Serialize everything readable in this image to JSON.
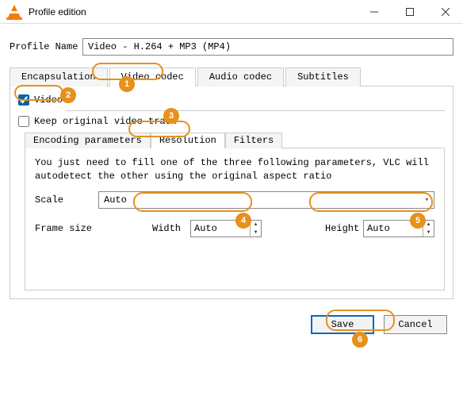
{
  "window": {
    "title": "Profile edition"
  },
  "profile": {
    "label": "Profile Name",
    "value": "Video - H.264 + MP3 (MP4)"
  },
  "tabs": {
    "encapsulation": "Encapsulation",
    "video": "Video codec",
    "audio": "Audio codec",
    "subs": "Subtitles"
  },
  "video": {
    "checkbox": "Video",
    "keep": "Keep original video track",
    "subtabs": {
      "enc": "Encoding parameters",
      "res": "Resolution",
      "filt": "Filters"
    },
    "help": "You just need to fill one of the three following parameters, VLC will autodetect the other using the original aspect ratio",
    "scale": {
      "label": "Scale",
      "value": "Auto"
    },
    "frame": {
      "label": "Frame size",
      "width": {
        "label": "Width",
        "value": "Auto"
      },
      "height": {
        "label": "Height",
        "value": "Auto"
      }
    }
  },
  "buttons": {
    "save": "Save",
    "cancel": "Cancel"
  },
  "badges": {
    "b1": "1",
    "b2": "2",
    "b3": "3",
    "b4": "4",
    "b5": "5",
    "b6": "6"
  }
}
